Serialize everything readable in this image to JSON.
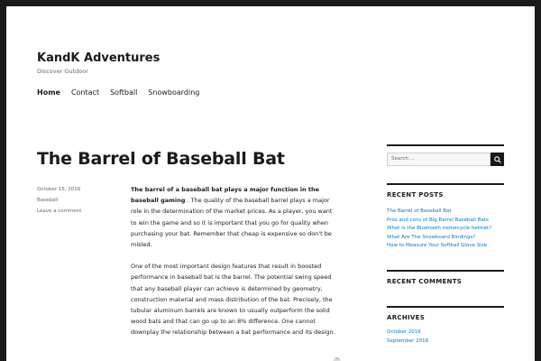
{
  "site": {
    "title": "KandK Adventures",
    "description": "Discover Outdoor"
  },
  "nav": {
    "items": [
      {
        "label": "Home",
        "active": true
      },
      {
        "label": "Contact",
        "active": false
      },
      {
        "label": "Softball",
        "active": false
      },
      {
        "label": "Snowboarding",
        "active": false
      }
    ]
  },
  "post": {
    "title": "The Barrel of Baseball Bat",
    "date": "October 15, 2016",
    "category": "Baseball",
    "comments_link": "Leave a comment",
    "lead_bold": "The barrel of a baseball bat plays a major function in the baseball gaming",
    "lead_rest": ". The quality of the baseball barrel plays a major role in the determination of the market prices. As a player, you want to win the game and so it is important that you go for quality when purchasing your bat. Remember that cheap is expensive so don't be misled.",
    "paragraph_2": "One of the most important design features that result in boosted performance in baseball bat is the barrel. The potential swing speed that any baseball player can achieve is determined by geometry, construction material and mass distribution of the bat. Precisely, the tubular aluminum barrels are known to usually outperform the solid wood bats and that can go up to an 8% difference. One cannot downplay the relationship between a bat performance and its design."
  },
  "sidebar": {
    "search_placeholder": "Search ...",
    "recent_posts_title": "RECENT POSTS",
    "recent_posts": [
      "The Barrel of Baseball Bat",
      "Pros and cons of Big Barrel Baseball Bats",
      "What is the Bluetooth motorcycle helmet?",
      "What Are The Snowboard Bindings?",
      "How to Measure Your Softball Glove Size"
    ],
    "recent_comments_title": "RECENT COMMENTS",
    "archives_title": "ARCHIVES",
    "archives": [
      "October 2016",
      "September 2016"
    ]
  },
  "colors": {
    "link": "#007acc",
    "text": "#1a1a1a",
    "muted": "#686868",
    "frame": "#1a1a1a"
  }
}
